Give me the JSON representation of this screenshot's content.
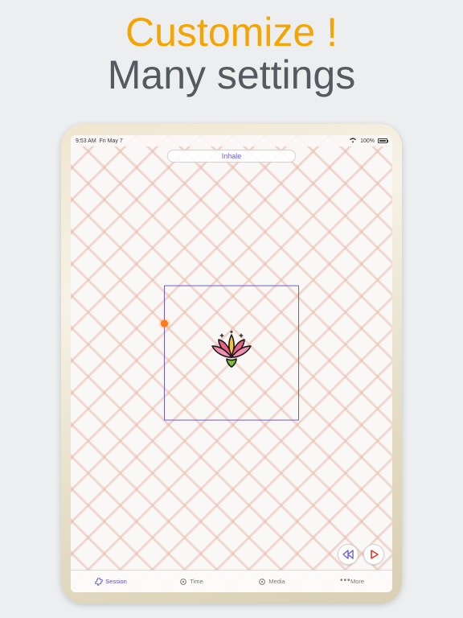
{
  "headline": {
    "line1": "Customize !",
    "line2": "Many settings"
  },
  "statusbar": {
    "time": "9:53 AM",
    "date": "Fri May 7",
    "battery": "100%"
  },
  "phase_label": "Inhale",
  "controls": {
    "rewind": "rewind",
    "play": "play"
  },
  "tabs": {
    "session": "Session",
    "time": "Time",
    "media": "Media",
    "more": "More"
  }
}
